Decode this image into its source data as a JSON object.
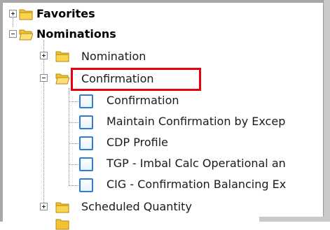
{
  "tree": {
    "favorites": {
      "label": "Favorites",
      "icon": "folder-closed-icon",
      "state": "collapsed"
    },
    "nominations": {
      "label": "Nominations",
      "icon": "folder-open-icon",
      "state": "expanded"
    },
    "nomination": {
      "label": "Nomination",
      "icon": "folder-closed-icon",
      "state": "collapsed"
    },
    "confirmation_folder": {
      "label": "Confirmation",
      "icon": "folder-open-icon",
      "state": "expanded",
      "highlighted": true
    },
    "confirmation_items": [
      {
        "label": "Confirmation",
        "icon": "page-icon"
      },
      {
        "label": "Maintain Confirmation by Excep",
        "icon": "page-icon"
      },
      {
        "label": "CDP Profile",
        "icon": "page-icon"
      },
      {
        "label": "TGP - Imbal Calc Operational an",
        "icon": "page-icon"
      },
      {
        "label": "CIG - Confirmation Balancing Ex",
        "icon": "page-icon"
      }
    ],
    "scheduled_quantity": {
      "label": "Scheduled Quantity",
      "icon": "folder-closed-icon",
      "state": "collapsed"
    }
  },
  "colors": {
    "highlight": "#e8000b",
    "item_icon_border": "#2b7dd8",
    "folder": "#f2c230"
  }
}
